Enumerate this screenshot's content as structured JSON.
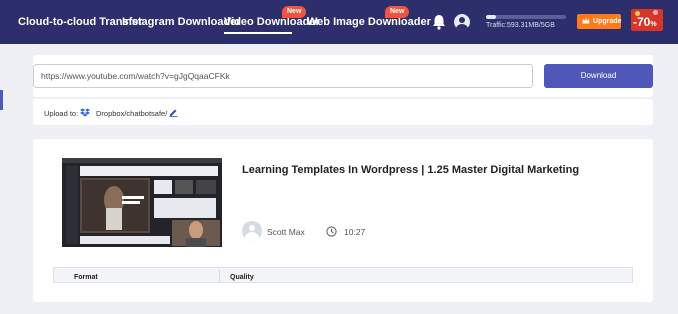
{
  "nav": {
    "items": [
      {
        "label": "Cloud-to-cloud Transfer"
      },
      {
        "label": "Instagram Downloader"
      },
      {
        "label": "Video Downloader",
        "badge": "New"
      },
      {
        "label": "Web Image Downloader",
        "badge": "New"
      }
    ],
    "traffic_text": "Traffic:593.31MB/5GB",
    "traffic_fraction": 0.12,
    "upgrade_label": "Upgrade",
    "promo_text": "-70",
    "promo_unit": "%"
  },
  "search": {
    "url_value": "https://www.youtube.com/watch?v=gJgQqaaCFKk",
    "download_label": "Download"
  },
  "upload": {
    "label": "Upload to:",
    "path": "Dropbox/chatbotsafe/"
  },
  "video": {
    "title": "Learning Templates In Wordpress | 1.25 Master Digital Marketing",
    "author": "Scott Max",
    "duration": "10:27"
  },
  "table": {
    "columns": [
      "Format",
      "Quality"
    ]
  },
  "colors": {
    "nav_bg": "#2c2f6b",
    "accent": "#4f58b8",
    "badge": "#f0543e",
    "upgrade": "#ff7a1a",
    "promo": "#d8352a"
  },
  "icons": [
    "bell-icon",
    "user-icon",
    "crown-icon",
    "dropbox-icon",
    "edit-icon",
    "clock-icon"
  ]
}
